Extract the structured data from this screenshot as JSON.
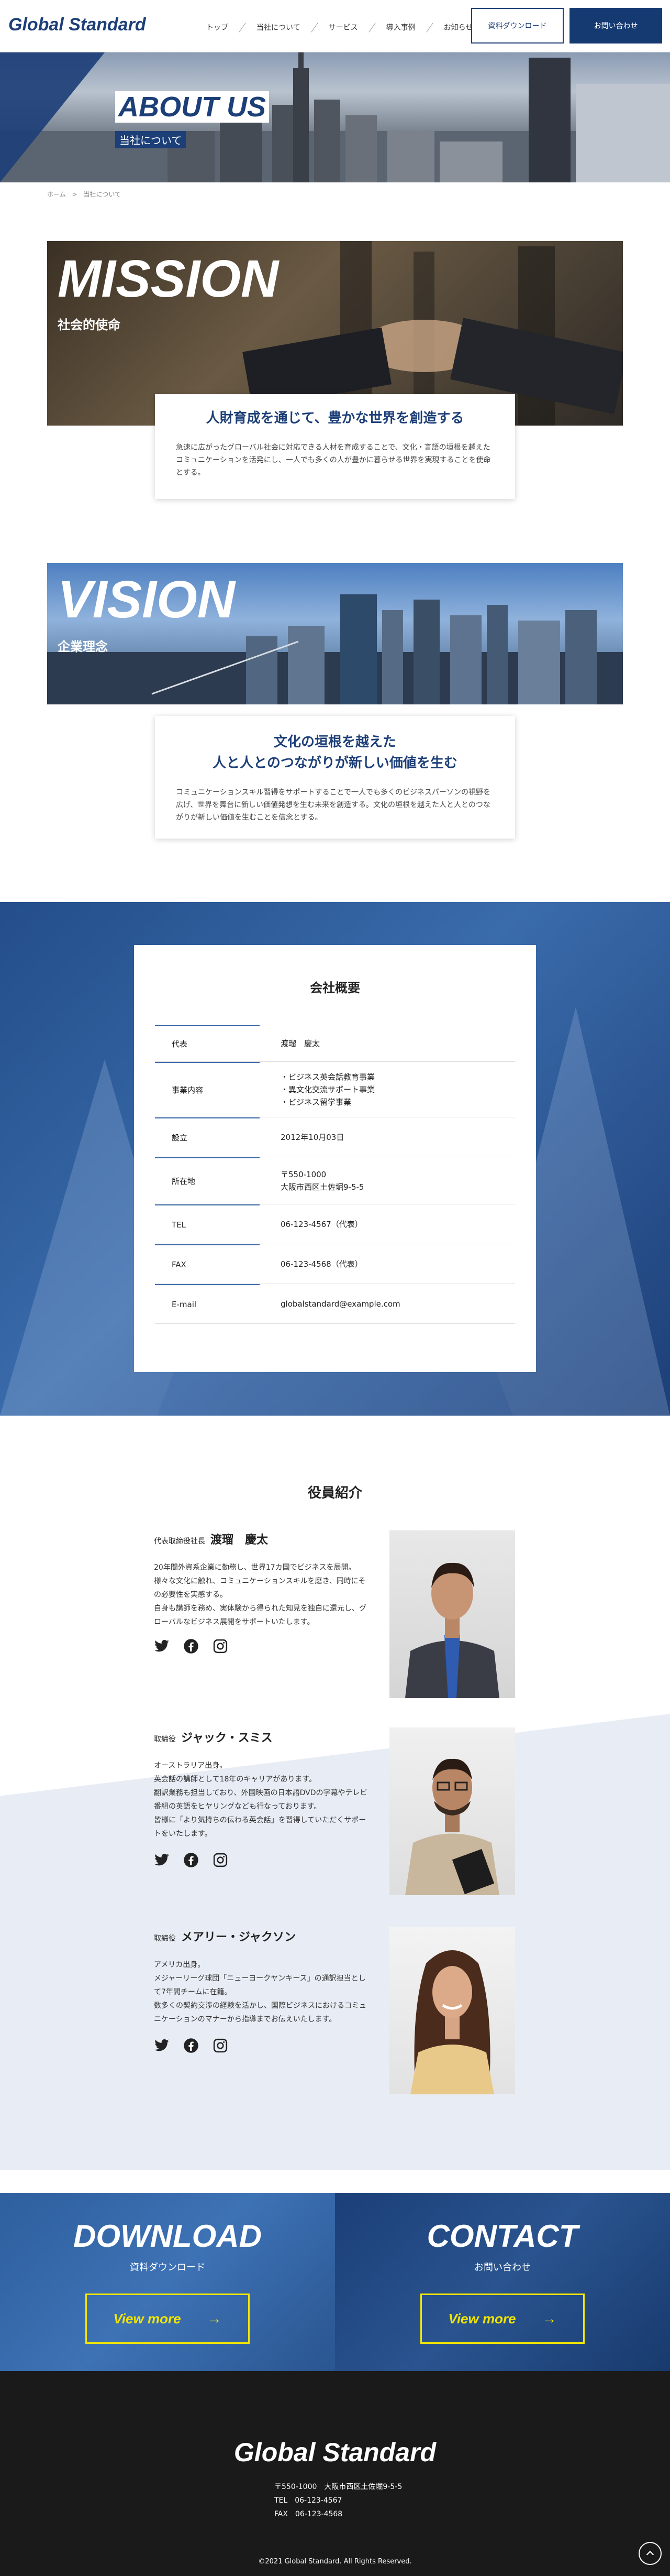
{
  "header": {
    "logo": "Global Standard",
    "nav": [
      "トップ",
      "当社について",
      "サービス",
      "導入事例",
      "お知らせ"
    ],
    "download_label": "資料ダウンロード",
    "contact_label": "お問い合わせ"
  },
  "hero": {
    "title": "ABOUT US",
    "subtitle": "当社について"
  },
  "breadcrumb": {
    "home": "ホーム",
    "sep": ">",
    "current": "当社について"
  },
  "mission": {
    "big": "MISSION",
    "jp": "社会的使命",
    "heading": "人財育成を通じて、豊かな世界を創造する",
    "body": "急速に広がったグローバル社会に対応できる人材を育成することで、文化・言語の垣根を越えたコミュニケーションを活発にし、一人でも多くの人が豊かに暮らせる世界を実現することを使命とする。"
  },
  "vision": {
    "big": "VISION",
    "jp": "企業理念",
    "heading_line1": "文化の垣根を越えた",
    "heading_line2": "人と人とのつながりが新しい価値を生む",
    "body": "コミュニケーションスキル習得をサポートすることで一人でも多くのビジネスパーソンの視野を広げ、世界を舞台に新しい価値発想を生む未来を創造する。文化の垣根を越えた人と人とのつながりが新しい価値を生むことを信念とする。"
  },
  "overview": {
    "title": "会社概要",
    "rows": [
      {
        "key": "代表",
        "value": "渡瑠　慶太"
      },
      {
        "key": "事業内容",
        "value": "・ビジネス英会話教育事業\n・異文化交流サポート事業\n・ビジネス留学事業"
      },
      {
        "key": "設立",
        "value": "2012年10月03日"
      },
      {
        "key": "所在地",
        "value": "〒550-1000\n大阪市西区土佐堀9-5-5"
      },
      {
        "key": "TEL",
        "value": "06-123-4567（代表）"
      },
      {
        "key": "FAX",
        "value": "06-123-4568（代表）"
      },
      {
        "key": "E-mail",
        "value": "globalstandard@example.com"
      }
    ]
  },
  "officers": {
    "title": "役員紹介",
    "list": [
      {
        "role": "代表取締役社長",
        "name": "渡瑠　慶太",
        "bio": "20年間外資系企業に勤務し、世界17カ国でビジネスを展開。\n様々な文化に触れ、コミュニケーションスキルを磨き、同時にその必要性を実感する。\n自身も講師を務め、実体験から得られた知見を独自に還元し、グローバルなビジネス展開をサポートいたします。"
      },
      {
        "role": "取締役",
        "name": "ジャック・スミス",
        "bio": "オーストラリア出身。\n英会話の講師として18年のキャリアがあります。\n翻訳業務も担当しており、外国映画の日本語DVDの字幕やテレビ番組の英語をヒヤリングなども行なっております。\n皆様に「より気持ちの伝わる英会話」を習得していただくサポートをいたします。"
      },
      {
        "role": "取締役",
        "name": "メアリー・ジャクソン",
        "bio": "アメリカ出身。\nメジャーリーグ球団「ニューヨークヤンキース」の通訳担当として7年間チームに在籍。\n数多くの契約交渉の経験を活かし、国際ビジネスにおけるコミュニケーションのマナーから指導までお伝えいたします。"
      }
    ]
  },
  "cta": {
    "download": {
      "big": "DOWNLOAD",
      "jp": "資料ダウンロード",
      "button": "View more"
    },
    "contact": {
      "big": "CONTACT",
      "jp": "お問い合わせ",
      "button": "View more"
    }
  },
  "footer": {
    "logo": "Global Standard",
    "address": "〒550-1000　大阪市西区土佐堀9-5-5",
    "tel": "TEL　06-123-4567",
    "fax": "FAX　06-123-4568",
    "copyright": "©2021 Global Standard. All Rights Reserved."
  },
  "colors": {
    "brand": "#1d3f78",
    "accent_yellow": "#f2e500",
    "footer": "#1a1a1a"
  },
  "icons": [
    "twitter-icon",
    "facebook-icon",
    "instagram-icon",
    "arrow-right-icon",
    "chevron-up-icon"
  ]
}
